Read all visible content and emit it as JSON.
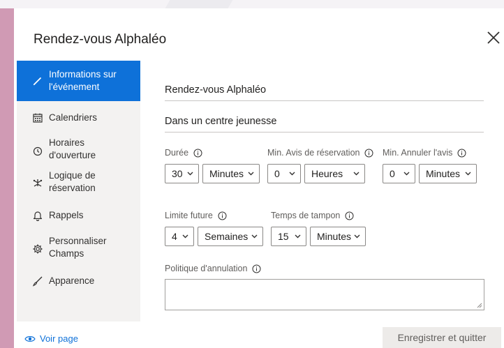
{
  "dialog": {
    "title": "Rendez-vous Alphaléo",
    "close_icon": "close-icon"
  },
  "sidebar": {
    "items": [
      {
        "label": "Informations sur\nl'événement",
        "icon": "pencil-icon",
        "active": true
      },
      {
        "label": "Calendriers",
        "icon": "calendar-icon",
        "active": false
      },
      {
        "label": "Horaires\nd'ouverture",
        "icon": "clock-icon",
        "active": false
      },
      {
        "label": "Logique de\nréservation",
        "icon": "logic-icon",
        "active": false
      },
      {
        "label": "Rappels",
        "icon": "bell-icon",
        "active": false
      },
      {
        "label": "Personnaliser\nChamps",
        "icon": "settings-icon",
        "active": false
      },
      {
        "label": "Apparence",
        "icon": "brush-icon",
        "active": false
      }
    ]
  },
  "form": {
    "event_name": "Rendez-vous Alphaléo",
    "location": "Dans un centre jeunesse",
    "duration": {
      "label": "Durée",
      "value": "30",
      "unit": "Minutes"
    },
    "min_booking_notice": {
      "label": "Min. Avis de réservation",
      "value": "0",
      "unit": "Heures"
    },
    "min_cancel_notice": {
      "label": "Min. Annuler l'avis",
      "value": "0",
      "unit": "Minutes"
    },
    "future_limit": {
      "label": "Limite future",
      "value": "4",
      "unit": "Semaines"
    },
    "buffer_time": {
      "label": "Temps de tampon",
      "value": "15",
      "unit": "Minutes"
    },
    "cancellation_policy": {
      "label": "Politique d'annulation",
      "value": ""
    }
  },
  "footer": {
    "view_page": "Voir page",
    "save_button": "Enregistrer et quitter"
  },
  "colors": {
    "accent": "#0e71d9",
    "backdrop": "#d09ab4",
    "sidebar": "#f3f2f1"
  }
}
